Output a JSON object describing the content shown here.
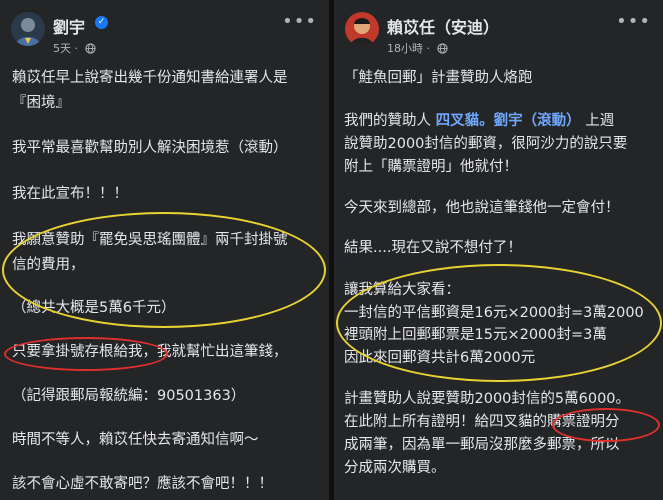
{
  "left_post": {
    "author": "劉宇",
    "time": "5天",
    "lines": [
      "賴苡任早上說寄出幾千份通知書給連署人是",
      "『困境』",
      "我平常最喜歡幫助別人解決困境惹（滾動）",
      "我在此宣布！！！",
      "我願意贊助『罷免吳思瑤團體』兩千封掛號",
      "信的費用，",
      "（總共大概是5萬6千元）",
      "只要拿掛號存根給我，我就幫忙出這筆錢，",
      "（記得跟郵局報統編：90501363）",
      "時間不等人，賴苡任快去寄通知信啊～",
      "該不會心虛不敢寄吧？應該不會吧！！！"
    ]
  },
  "right_post": {
    "author": "賴苡任（安迪）",
    "time": "18小時",
    "line1": "「鮭魚回郵」計畫贊助人烙跑",
    "line2_prefix": "我們的贊助人 ",
    "line2_link1": "四叉貓",
    "line2_dot": "。",
    "line2_link2": "劉宇（滾動）",
    "line2_suffix": " 上週",
    "line3": "說贊助2000封信的郵資，很阿沙力的說只要",
    "line4": "附上「購票證明」他就付！",
    "line5": "今天來到總部，他也說這筆錢他一定會付！",
    "line6": "結果....現在又說不想付了！",
    "line7": "讓我算給大家看：",
    "line8": "一封信的平信郵資是16元×2000封=3萬2000",
    "line9": "裡頭附上回郵郵票是15元×2000封=3萬",
    "line10": "因此來回郵資共計6萬2000元",
    "line11": "計畫贊助人說要贊助2000封信的5萬6000。",
    "line12": "在此附上所有證明！給四叉貓的購票證明分",
    "line13": "成兩筆，因為單一郵局沒那麼多郵票，所以",
    "line14": "分成兩次購買。"
  },
  "colors": {
    "panel_bg": "#242526",
    "text": "#e4e6eb",
    "secondary_text": "#b0b3b8",
    "link": "#6fa8ff",
    "verified_badge": "#1877f2",
    "highlight_yellow": "#e8d233",
    "highlight_red": "#e0302e"
  },
  "icons": [
    "verified-badge-icon",
    "globe-icon",
    "more-options-icon"
  ]
}
